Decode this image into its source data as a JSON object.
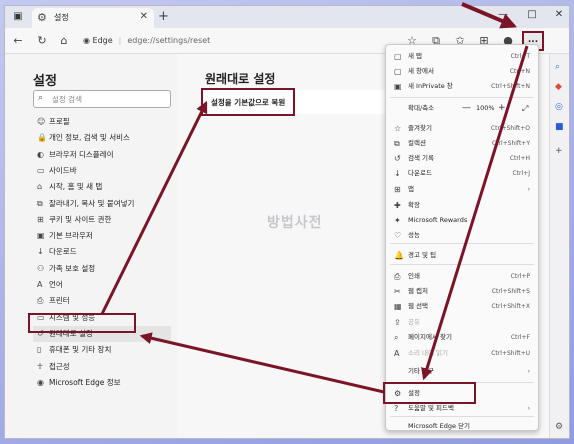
{
  "browser": {
    "tab_title": "설정",
    "url_brand": "Edge",
    "url_path": "edge://settings/reset",
    "more_button": "..."
  },
  "sidebar": {
    "title": "설정",
    "search_placeholder": "설정 검색",
    "items": [
      {
        "icon": "profile-icon",
        "glyph": "☺",
        "label": "프로필"
      },
      {
        "icon": "lock-icon",
        "glyph": "🔒",
        "label": "개인 정보, 검색 및 서비스"
      },
      {
        "icon": "palette-icon",
        "glyph": "◐",
        "label": "브라우저 디스플레이"
      },
      {
        "icon": "sidebar-icon",
        "glyph": "▭",
        "label": "사이드바"
      },
      {
        "icon": "home-icon",
        "glyph": "⌂",
        "label": "시작, 홈 및 새 탭"
      },
      {
        "icon": "share-icon",
        "glyph": "⧉",
        "label": "잘라내기, 복사 및 붙여넣기"
      },
      {
        "icon": "cookie-icon",
        "glyph": "⊞",
        "label": "쿠키 및 사이트 권한"
      },
      {
        "icon": "browser-icon",
        "glyph": "▣",
        "label": "기본 브라우저"
      },
      {
        "icon": "download-icon",
        "glyph": "↓",
        "label": "다운로드"
      },
      {
        "icon": "family-icon",
        "glyph": "⚇",
        "label": "가족 보호 설정"
      },
      {
        "icon": "language-icon",
        "glyph": "A",
        "label": "언어"
      },
      {
        "icon": "printer-icon",
        "glyph": "⎙",
        "label": "프린터"
      },
      {
        "icon": "system-icon",
        "glyph": "▭",
        "label": "시스템 및 성능"
      },
      {
        "icon": "reset-icon",
        "glyph": "↺",
        "label": "원래대로 설정"
      },
      {
        "icon": "phone-icon",
        "glyph": "▯",
        "label": "휴대폰 및 기타 장치"
      },
      {
        "icon": "accessibility-icon",
        "glyph": "☥",
        "label": "접근성"
      },
      {
        "icon": "edge-icon",
        "glyph": "◉",
        "label": "Microsoft Edge 정보"
      }
    ]
  },
  "main": {
    "title": "원래대로 설정",
    "reset_label": "설정을 기본값으로 복원"
  },
  "watermark": "방법사전",
  "menu": {
    "items": [
      {
        "icon": "new-tab-icon",
        "glyph": "▢",
        "label": "새 탭",
        "shortcut": "Ctrl+T"
      },
      {
        "icon": "new-window-icon",
        "glyph": "▢",
        "label": "새 창에서",
        "shortcut": "Ctrl+N"
      },
      {
        "icon": "inprivate-icon",
        "glyph": "▣",
        "label": "새 InPrivate 창",
        "shortcut": "Ctrl+Shift+N"
      },
      {
        "icon": "favorites-icon",
        "glyph": "☆",
        "label": "즐겨찾기",
        "shortcut": "Ctrl+Shift+O"
      },
      {
        "icon": "collections-icon",
        "glyph": "⧉",
        "label": "컬렉션",
        "shortcut": "Ctrl+Shift+Y"
      },
      {
        "icon": "history-icon",
        "glyph": "↺",
        "label": "검색 기록",
        "shortcut": "Ctrl+H"
      },
      {
        "icon": "download-icon",
        "glyph": "↓",
        "label": "다운로드",
        "shortcut": "Ctrl+J"
      },
      {
        "icon": "apps-icon",
        "glyph": "⊞",
        "label": "앱",
        "shortcut": "›"
      },
      {
        "icon": "extensions-icon",
        "glyph": "✚",
        "label": "확장",
        "shortcut": ""
      },
      {
        "icon": "rewards-icon",
        "glyph": "✦",
        "label": "Microsoft Rewards",
        "shortcut": ""
      },
      {
        "icon": "performance-icon",
        "glyph": "♡",
        "label": "성능",
        "shortcut": ""
      },
      {
        "icon": "alerts-icon",
        "glyph": "🔔",
        "label": "경고 및 팁",
        "shortcut": ""
      },
      {
        "icon": "print-icon",
        "glyph": "⎙",
        "label": "인쇄",
        "shortcut": "Ctrl+P"
      },
      {
        "icon": "web-capture-icon",
        "glyph": "✂",
        "label": "웹 캡처",
        "shortcut": "Ctrl+Shift+S"
      },
      {
        "icon": "web-select-icon",
        "glyph": "▦",
        "label": "웹 선택",
        "shortcut": "Ctrl+Shift+X"
      },
      {
        "icon": "share-icon",
        "glyph": "⇪",
        "label": "공유",
        "shortcut": "",
        "dim": true
      },
      {
        "icon": "find-icon",
        "glyph": "⌕",
        "label": "페이지에서 찾기",
        "shortcut": "Ctrl+F"
      },
      {
        "icon": "read-aloud-icon",
        "glyph": "A",
        "label": "소리 내어 읽기",
        "shortcut": "Ctrl+Shift+U",
        "dim": true
      },
      {
        "icon": "more-tools-icon",
        "glyph": "",
        "label": "기타 도구",
        "shortcut": "›"
      },
      {
        "icon": "settings-icon",
        "glyph": "⚙",
        "label": "설정",
        "shortcut": ""
      },
      {
        "icon": "help-icon",
        "glyph": "?",
        "label": "도움말 및 피드백",
        "shortcut": "›"
      },
      {
        "icon": "close-edge-icon",
        "glyph": "",
        "label": "Microsoft Edge 닫기",
        "shortcut": ""
      }
    ],
    "zoom_label": "확대/축소",
    "zoom_value": "100%"
  },
  "colors": {
    "highlight": "#7a1426"
  }
}
